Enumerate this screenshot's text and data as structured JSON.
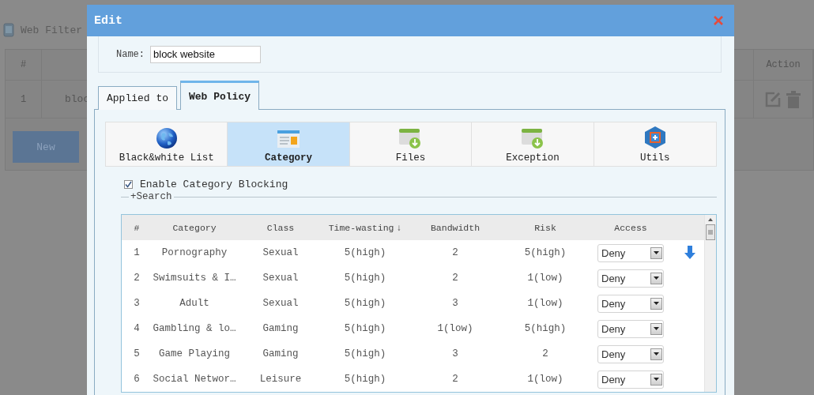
{
  "background": {
    "title": "Web Filter",
    "table": {
      "columns": [
        "#",
        "Action"
      ],
      "rows": [
        {
          "number": "1",
          "column_2": "bloc"
        }
      ]
    },
    "new_button": "New"
  },
  "dialog": {
    "title": "Edit",
    "name_label": "Name:",
    "name_value": "block website",
    "tabs": [
      {
        "label": "Applied to",
        "selected": false
      },
      {
        "label": "Web Policy",
        "selected": true
      }
    ],
    "sections": [
      {
        "label": "Black&white List",
        "kind": "globe",
        "selected": false
      },
      {
        "label": "Category",
        "kind": "card",
        "selected": true
      },
      {
        "label": "Files",
        "kind": "download",
        "selected": false
      },
      {
        "label": "Exception",
        "kind": "download",
        "selected": false
      },
      {
        "label": "Utils",
        "kind": "hexagon",
        "selected": false
      }
    ],
    "enable": {
      "label": "Enable Category Blocking",
      "checked": true
    },
    "search_label": "+Search",
    "table": {
      "columns": [
        {
          "label": "#"
        },
        {
          "label": "Category"
        },
        {
          "label": "Class"
        },
        {
          "label": "Time-wasting",
          "sort_mark": "↓"
        },
        {
          "label": "Bandwidth"
        },
        {
          "label": "Risk"
        },
        {
          "label": "Access"
        }
      ],
      "rows": [
        {
          "cells": [
            "1",
            "Pornography",
            "Sexual",
            "5(high)",
            "2",
            "5(high)"
          ],
          "access": "Deny",
          "hovered": true
        },
        {
          "cells": [
            "2",
            "Swimsuits & I…",
            "Sexual",
            "5(high)",
            "2",
            "1(low)"
          ],
          "access": "Deny",
          "hovered": false
        },
        {
          "cells": [
            "3",
            "Adult",
            "Sexual",
            "5(high)",
            "3",
            "1(low)"
          ],
          "access": "Deny",
          "hovered": false
        },
        {
          "cells": [
            "4",
            "Gambling & lo…",
            "Gaming",
            "5(high)",
            "1(low)",
            "5(high)"
          ],
          "access": "Deny",
          "hovered": false
        },
        {
          "cells": [
            "5",
            "Game Playing",
            "Gaming",
            "5(high)",
            "3",
            "2"
          ],
          "access": "Deny",
          "hovered": false
        },
        {
          "cells": [
            "6",
            "Social Networ…",
            "Leisure",
            "5(high)",
            "2",
            "1(low)"
          ],
          "access": "Deny",
          "hovered": false
        }
      ]
    }
  }
}
